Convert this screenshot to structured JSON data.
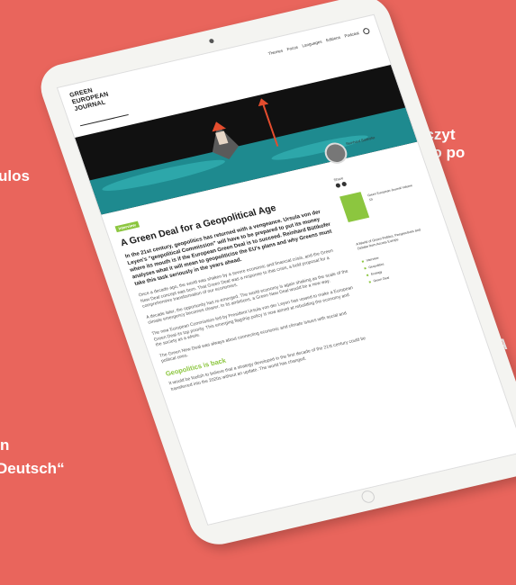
{
  "background_texts": [
    "ulos",
    "„Przeczyt",
    "po po",
    "« A",
    "n",
    "Deutsch“"
  ],
  "header": {
    "logo_lines": [
      "GREEN",
      "EUROPEAN",
      "JOURNAL"
    ],
    "nav": [
      "Themes",
      "Focus",
      "Languages",
      "Editions",
      "Podcast"
    ]
  },
  "article": {
    "category": "Interview",
    "title": "A Green Deal for a Geopolitical Age",
    "lead": "In the 21st century, geopolitics has returned with a vengeance. Ursula von der Leyen’s “geopolitical Commission” will have to be prepared to put its money where its mouth is if the European Green Deal is to succeed. Reinhard Bütikofer analyses what it will mean to geopoliticise the EU’s plans and why Greens must take this task seriously in the years ahead.",
    "paragraphs": [
      "Once a decade ago, the world was shaken by a severe economic and financial crisis, and the Green New Deal concept was born. That Green Deal was a response to that crisis, a bold proposal for a comprehensive transformation of our economies.",
      "A decade later, the opportunity has re-emerged. The world economy is again shaking as the scale of the climate emergency becomes clearer. In its ambitions, a Green New Deal would be a new way.",
      "The new European Commission led by President Ursula von der Leyen has vowed to make a European Green Deal its top priority. This emerging flagship policy is now aimed at rebuilding the economy and the society as a whole.",
      "The Green New Deal was always about connecting economic and climate issues with social and political ones."
    ],
    "subhead": "Geopolitics is back",
    "after_subhead": "It would be foolish to believe that a strategy developed in the first decade of the 21st century could be transferred into the 2020s without an update. The world has changed."
  },
  "aside": {
    "author": "Reinhard Bütikofer",
    "share_label": "Share",
    "book_caption": "Green European Journal Volume 19",
    "tagline": "A World of Green Politics, Perspectives and Debate from Across Europe",
    "links": [
      "Interview",
      "Geopolitics",
      "Ecology",
      "Green Deal"
    ]
  },
  "colors": {
    "background": "#e9655c",
    "accent_green": "#8cc63f",
    "hero_water": "#1e8a8f",
    "hero_red": "#e44d2e"
  }
}
